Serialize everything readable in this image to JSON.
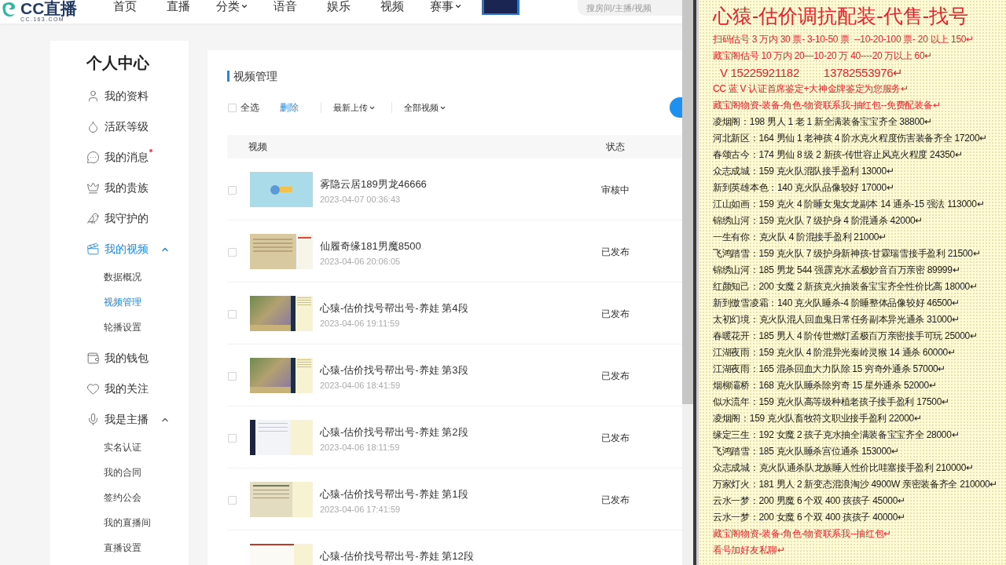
{
  "nav": {
    "logo": {
      "name": "CC直播",
      "domain": "CC.163.COM"
    },
    "items": [
      {
        "label": "首页",
        "dropdown": false
      },
      {
        "label": "直播",
        "dropdown": false
      },
      {
        "label": "分类",
        "dropdown": true
      },
      {
        "label": "语音",
        "dropdown": false
      },
      {
        "label": "娱乐",
        "dropdown": false
      },
      {
        "label": "视频",
        "dropdown": false
      },
      {
        "label": "赛事",
        "dropdown": true
      }
    ],
    "search": {
      "placeholder": "搜房间/主播/视频"
    }
  },
  "sidebar": {
    "title": "个人中心",
    "items": [
      {
        "label": "我的资料",
        "selected": false,
        "dot": false
      },
      {
        "label": "活跃等级",
        "selected": false,
        "dot": false
      },
      {
        "label": "我的消息",
        "selected": false,
        "dot": true
      },
      {
        "label": "我的贵族",
        "selected": false,
        "dot": false
      },
      {
        "label": "我守护的",
        "selected": false,
        "dot": false
      },
      {
        "label": "我的视频",
        "selected": true,
        "dot": false,
        "expanded": true,
        "children": [
          {
            "label": "数据概况",
            "selected": false
          },
          {
            "label": "视频管理",
            "selected": true
          },
          {
            "label": "轮播设置",
            "selected": false
          }
        ]
      },
      {
        "label": "我的钱包",
        "selected": false,
        "dot": false
      },
      {
        "label": "我的关注",
        "selected": false,
        "dot": false
      },
      {
        "label": "我是主播",
        "selected": false,
        "dot": false,
        "expanded": true,
        "children": [
          {
            "label": "实名认证",
            "selected": false
          },
          {
            "label": "我的合同",
            "selected": false
          },
          {
            "label": "签约公会",
            "selected": false
          },
          {
            "label": "我的直播间",
            "selected": false
          },
          {
            "label": "直播设置",
            "selected": false
          }
        ]
      }
    ]
  },
  "main": {
    "title": "视频管理",
    "toolbar": {
      "select_all": {
        "label": "全选",
        "checked": false
      },
      "delete_label": "删除",
      "filters": [
        "最新上传",
        "全部视频"
      ]
    },
    "table": {
      "columns": [
        "视频",
        "状态"
      ],
      "rows": [
        {
          "kind": "sky",
          "title": "雾隐云居189男龙46666",
          "date": "2023-04-07 00:36:43",
          "status": "审核中",
          "checked": false
        },
        {
          "kind": "page",
          "title": "仙履奇缘181男魔8500",
          "date": "2023-04-06 20:06:05",
          "status": "已发布",
          "checked": false
        },
        {
          "kind": "game",
          "title": "心猿-估价找号帮出号-养娃 第4段",
          "date": "2023-04-06 19:11:59",
          "status": "已发布",
          "checked": false
        },
        {
          "kind": "game",
          "title": "心猿-估价找号帮出号-养娃 第3段",
          "date": "2023-04-06 18:41:59",
          "status": "已发布",
          "checked": false
        },
        {
          "kind": "dark",
          "title": "心猿-估价找号帮出号-养娃 第2段",
          "date": "2023-04-06 18:11:59",
          "status": "已发布",
          "checked": false
        },
        {
          "kind": "sheet",
          "title": "心猿-估价找号帮出号-养娃 第1段",
          "date": "2023-04-06 17:41:59",
          "status": "已发布",
          "checked": false
        },
        {
          "kind": "memo",
          "title": "心猿-估价找号帮出号-养娃 第12段"
        }
      ]
    }
  },
  "document": {
    "title": "心猿-估价调抗配装-代售-找号",
    "lines": [
      {
        "kind": "red",
        "text": "扫码估号 3 万内 30 票- 3-10-50 票  --10-20-100 票- 20 以上 150↵"
      },
      {
        "kind": "red",
        "text": "藏宝阁估号 10 万内 20—10-20 万 40----20 万以上 60↵"
      },
      {
        "kind": "phone",
        "text": "V 15225921182        13782553976↵"
      },
      {
        "kind": "red",
        "text": "CC 蓝 V 认证首席鉴定+大神金牌鉴定为您服务↵"
      },
      {
        "kind": "red",
        "text": "藏宝阁物资-装备-角色-物资联系我-抽红包--免费配装备↵"
      },
      {
        "kind": "plain",
        "text": "凌烟阁：198 男人 1 老 1 新全满装备宝宝齐全 38800↵"
      },
      {
        "kind": "plain",
        "text": "河北新区：164 男仙 1 老神孩 4 阶水克火程度伤害装备齐全 17200↵"
      },
      {
        "kind": "plain",
        "text": "春颂古今：174 男仙 8 级 2 新孩-传世容止风克火程度 24350↵"
      },
      {
        "kind": "plain",
        "text": "众志成城：159 克火队混队接手盈利 13000↵"
      },
      {
        "kind": "plain",
        "text": "新到英雄本色：140 克火队品像较好 17000↵"
      },
      {
        "kind": "plain",
        "text": "江山如画：159 克火 4 阶睡女鬼女龙副本 14 通杀-15 强法 113000↵"
      },
      {
        "kind": "plain",
        "text": "锦绣山河：159 克火队 7 级护身 4 阶混通杀 42000↵"
      },
      {
        "kind": "plain",
        "text": "一生有你：克火队 4 阶混接手盈利 21000↵"
      },
      {
        "kind": "plain",
        "text": "飞鸿踏雪：159 克火队 7 级护身新神孩-甘霖瑞雪接手盈利 21500↵"
      },
      {
        "kind": "plain",
        "text": "锦绣山河：185 男龙 544 强霹克水孟极妙音百万亲密 89999↵"
      },
      {
        "kind": "plain",
        "text": "红颜知己：200 女魔 2 新孩克火抽装备宝宝齐全性价比高 18000↵"
      },
      {
        "kind": "plain",
        "text": "新到傲雪凌霜：140 克火队睡杀-4 阶睡整体品像较好 46500↵"
      },
      {
        "kind": "plain",
        "text": "太初幻境：克火队混人回血鬼日常任务副本异光通杀 31000↵"
      },
      {
        "kind": "plain",
        "text": "春暖花开：185 男人 4 阶传世燃灯孟极百万亲密接手可玩 25000↵"
      },
      {
        "kind": "plain",
        "text": "江湖夜雨：159 克火队 4 阶混异光秦岭灵猴 14 通杀 60000↵"
      },
      {
        "kind": "plain",
        "text": "江湖夜雨：165 混杀回血大力队除 15 穷奇外通杀 57000↵"
      },
      {
        "kind": "plain",
        "text": "烟柳灞桥：168 克火队睡杀除穷奇 15 星外通杀 52000↵"
      },
      {
        "kind": "plain",
        "text": "似水流年：159 克火队高等级种植老孩子接手盈利 17500↵"
      },
      {
        "kind": "plain",
        "text": "凌烟阁：159 克火队畜牧符文职业接手盈利 22000↵"
      },
      {
        "kind": "plain",
        "text": "缘定三生：192 女魔 2 孩子克水抽全满装备宝宝齐全 28000↵"
      },
      {
        "kind": "plain",
        "text": "飞鸿踏雪：185 克火队睡杀宫位通杀 153000↵"
      },
      {
        "kind": "plain",
        "text": "众志成城：克火队通杀队龙族睡人性价比哇塞接手盈利 210000↵"
      },
      {
        "kind": "plain",
        "text": "万家灯火：181 男人 2 新变态混浪淘沙 4900W 亲密装备齐全 210000↵"
      },
      {
        "kind": "plain",
        "text": "云水一梦：200 男魔 6 个双 400 孩孩子 45000↵"
      },
      {
        "kind": "plain",
        "text": "云水一梦：200 女魔 6 个双 400 孩孩子 40000↵"
      },
      {
        "kind": "red",
        "text": "藏宝阁物资-装备-角色-物资联系我--抽红包↵"
      },
      {
        "kind": "red",
        "text": "看号加好友私聊↵"
      }
    ]
  }
}
